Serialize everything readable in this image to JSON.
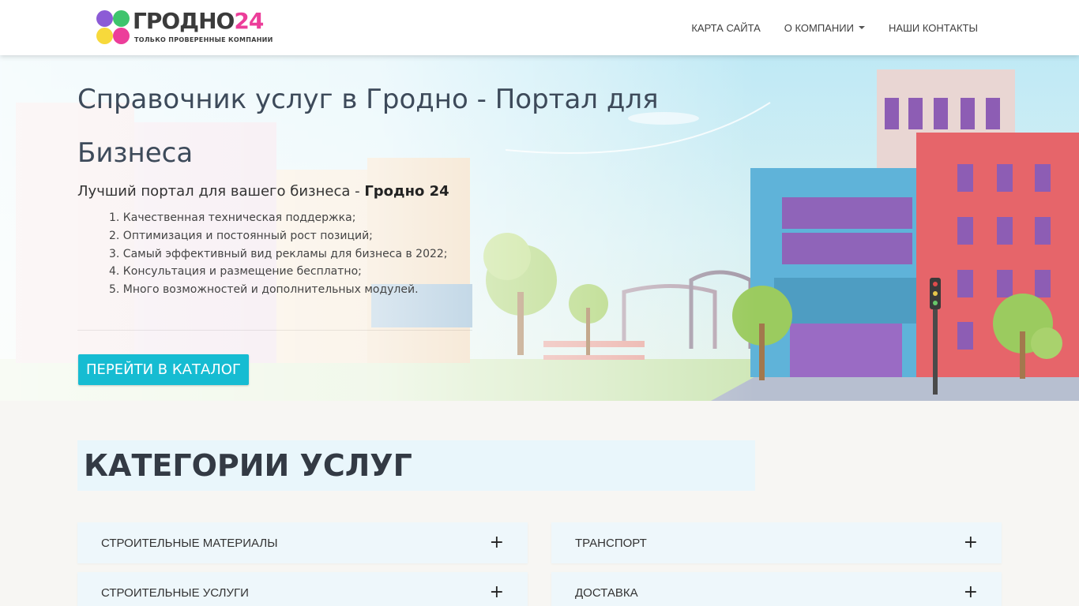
{
  "header": {
    "logo_text": "ГРОДНО",
    "logo_number": "24",
    "logo_tagline": "ТОЛЬКО ПРОВЕРЕННЫЕ КОМПАНИИ",
    "nav": [
      {
        "label": "КАРТА САЙТА"
      },
      {
        "label": "О КОМПАНИИ"
      },
      {
        "label": "НАШИ КОНТАКТЫ"
      }
    ]
  },
  "hero": {
    "title": "Справочник услуг в Гродно - Портал для Бизнеса",
    "subtitle_prefix": "Лучший портал для вашего бизнеса - ",
    "subtitle_bold": "Гродно 24",
    "features": [
      "1. Качественная техническая поддержка;",
      "2. Оптимизация и постоянный рост позиций;",
      "3. Самый эффективный вид рекламы для бизнеса в 2022;",
      "4. Консультация и размещение бесплатно;",
      "5. Много возможностей и дополнительных модулей."
    ],
    "cta_label": "ПЕРЕЙТИ В КАТАЛОГ"
  },
  "categories": {
    "heading": "КАТЕГОРИИ УСЛУГ",
    "items": [
      {
        "label": "СТРОИТЕЛЬНЫЕ МАТЕРИАЛЫ"
      },
      {
        "label": "ТРАНСПОРТ"
      },
      {
        "label": "СТРОИТЕЛЬНЫЕ УСЛУГИ"
      },
      {
        "label": "ДОСТАВКА"
      }
    ],
    "expand_symbol": "+"
  },
  "colors": {
    "accent": "#16bcd2",
    "logo_purple": "#8c5bd6",
    "logo_green": "#3ec46d",
    "logo_yellow": "#f7d93b",
    "logo_pink": "#ec3e9a"
  }
}
